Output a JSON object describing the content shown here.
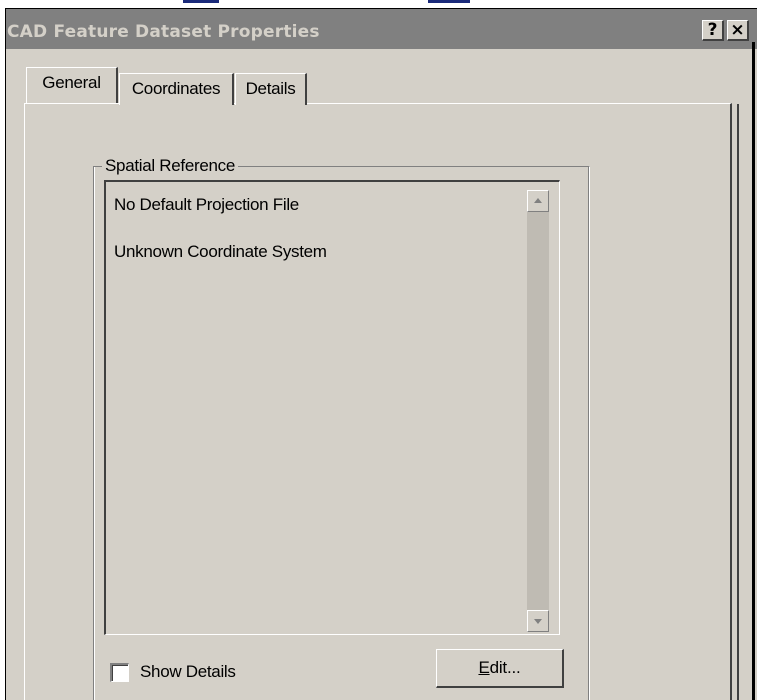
{
  "window": {
    "title": "CAD Feature Dataset Properties",
    "help_label": "?",
    "close_label": "×"
  },
  "tabs": [
    {
      "label": "General",
      "selected": true
    },
    {
      "label": "Coordinates",
      "selected": false
    },
    {
      "label": "Details",
      "selected": false
    }
  ],
  "spatial_reference": {
    "group_label": "Spatial Reference",
    "lines": [
      "No Default Projection File",
      "Unknown Coordinate System"
    ]
  },
  "show_details": {
    "label": "Show Details",
    "checked": false
  },
  "edit_button": {
    "mnemonic": "E",
    "rest": "dit..."
  },
  "colors": {
    "dialog_face": "#d4d0c8",
    "titlebar_inactive": "#808080",
    "title_text": "#d4d0c8"
  }
}
